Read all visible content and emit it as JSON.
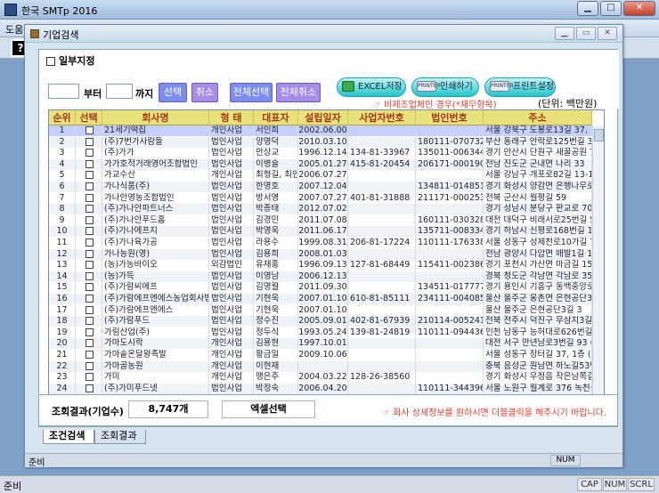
{
  "app": {
    "title": "한국 SMTp 2016",
    "menu": [
      "도움말"
    ]
  },
  "status": {
    "ready": "준비",
    "indicators": [
      "CAP",
      "NUM",
      "SCRL"
    ]
  },
  "window": {
    "title": "기업검색"
  },
  "filter": {
    "partial_label": "일부지정",
    "from_label": "부터",
    "to_label": "까지",
    "from_value": "",
    "to_value": "",
    "buttons": {
      "select": "선택",
      "cancel": "취소",
      "select_all": "전체선택",
      "cancel_all": "전체취소"
    },
    "actions": {
      "excel": "EXCEL저장",
      "print": "인쇄하기",
      "print_setup": "프린트설정",
      "print_icon_text": "PRINTER"
    },
    "warning": "비제조업체인 경우(*재무항목)",
    "unit": "(단위: 백만원)"
  },
  "grid": {
    "columns": [
      "순위",
      "선택",
      "회사명",
      "형 태",
      "대표자",
      "설립일자",
      "사업자번호",
      "법인번호",
      "주소"
    ],
    "rows": [
      [
        "1",
        "",
        "21세기떡집",
        "개인사업",
        "서인희",
        "2002.06.00",
        "",
        "",
        "서울 강북구 도봉로13길 37, 1층 (미아"
      ],
      [
        "2",
        "",
        "(주)7번가사람들",
        "법인사업",
        "양명덕",
        "2010.03.10",
        "",
        "180111-0707323",
        "부산 동래구 안락로125번길 38 (안락동"
      ],
      [
        "3",
        "",
        "(주)가가",
        "법인사업",
        "안상교",
        "1996.12.14",
        "134-81-33967",
        "135011-0063441",
        "경기 안산시 단원구 새꿀공원 7 (정"
      ],
      [
        "4",
        "",
        "가가호적거래영어조합법인",
        "법인사업",
        "이병술",
        "2005.01.27",
        "415-81-20454",
        "206171-0001900",
        "전남 진도군 군내면 나리 33"
      ],
      [
        "5",
        "",
        "가교수산",
        "개인사업",
        "최형길, 최인",
        "2006.07.27",
        "",
        "",
        "서울 강남구 개포로82길 13-11, 3층"
      ],
      [
        "6",
        "",
        "가나식품(주)",
        "법인사업",
        "한명호",
        "2007.12.04",
        "",
        "134811-0148511",
        "경기 화성시 양감면 은행나무로 34"
      ],
      [
        "7",
        "",
        "가나안영농조합법인",
        "법인사업",
        "방서영",
        "2007.07.27",
        "401-81-31888",
        "211171-0002539",
        "전북 군산시 월평길 59"
      ],
      [
        "8",
        "",
        "(주)가나안파트너스",
        "법인사업",
        "박종태",
        "2012.07.02",
        "",
        "",
        "경기 성남시 분당구 판교로 700, 비"
      ],
      [
        "9",
        "",
        "(주)가나안푸드홈",
        "법인사업",
        "김경민",
        "2011.07.08",
        "",
        "160111-0303282",
        "대전 대덕구 비래서로25번길 54"
      ],
      [
        "10",
        "",
        "(주)가나에프지",
        "법인사업",
        "박영욱",
        "2011.06.17",
        "",
        "135711-0083346",
        "경기 하남시 신평로168번길 104-7"
      ],
      [
        "11",
        "",
        "(주)가나육가공",
        "법인사업",
        "라용수",
        "1999.08.31",
        "206-81-17224",
        "110111-1763386",
        "서울 성동구 성제천로10가길 72-14"
      ],
      [
        "12",
        "",
        "가나농원(영)",
        "법인사업",
        "김용희",
        "2008.01.03",
        "",
        "",
        "전남 광양시 다압면 매발1길 110-11"
      ],
      [
        "13",
        "",
        "(농)가농바이오",
        "외감법인",
        "유재홍",
        "1996.09.13",
        "127-81-68449",
        "115411-0023863",
        "경기 포천시 가산면 마금길 151"
      ],
      [
        "14",
        "",
        "(농)가득",
        "법인사업",
        "이영남",
        "2006.12.13",
        "",
        "",
        "경북 청도군 각남면 각남로 35"
      ],
      [
        "15",
        "",
        "(주)가람씨에프",
        "법인사업",
        "김명월",
        "2011.09.30",
        "",
        "134511-0177772",
        "경기 용인시 기흥구 동백중앙로 191"
      ],
      [
        "16",
        "",
        "(주)가람에프엔에스농업회사법",
        "법인사업",
        "기현욱",
        "2007.01.10",
        "610-81-85111",
        "234111-0040851",
        "울산 울주군 웅촌면 은현공단3길 3"
      ],
      [
        "17",
        "",
        "(주)가람에프엔에스",
        "법인사업",
        "기현욱",
        "2007.01.10",
        "",
        "",
        "울산 울주군 은현공단3길 3"
      ],
      [
        "18",
        "",
        "(주)가람푸드",
        "법인사업",
        "정수진",
        "2005.09.01",
        "402-81-67939",
        "210114-0052410",
        "전북 전주시 덕진구 무삼지3길 9-1"
      ],
      [
        "19",
        "",
        "가림산업(주)",
        "법인사업",
        "정두식",
        "1993.05.24",
        "139-81-24819",
        "110111-0944367",
        "인천 남동구 능허대로626번길 63, 1"
      ],
      [
        "20",
        "",
        "가마도시락",
        "개인사업",
        "김용현",
        "1997.10.01",
        "",
        "",
        "대전 서구 만년남로3번길 93 (만년동"
      ],
      [
        "21",
        "",
        "가마솥온달왕족발",
        "개인사업",
        "황금일",
        "2009.10.06",
        "",
        "",
        "서울 성동구 장터길 37, 1층 (금호동"
      ],
      [
        "22",
        "",
        "가마골농원",
        "개인사업",
        "이현재",
        "",
        "",
        "",
        "충북 음성군 원남면 하노길53번길 14"
      ],
      [
        "23",
        "",
        "가미",
        "개인사업",
        "맹은주",
        "2004.03.22",
        "128-26-38560",
        "",
        "경기 화성시 우정읍 작은남쪽길 54"
      ],
      [
        "24",
        "",
        "(주)가미푸드넷",
        "법인사업",
        "박정숙",
        "2006.04.20",
        "",
        "110111-3443960",
        "서울 노원구 월계로 376 녹천중학교"
      ]
    ]
  },
  "result": {
    "label": "조회결과(기업수)",
    "count": "8,747개",
    "cell_select": "엑셀선택",
    "note": "회사 상세정보를 원하시면 더블클릭을 해주시기 바랍니다."
  },
  "tabs": [
    "조건검색",
    "조회결과"
  ],
  "inner_status": {
    "ready": "준비",
    "num": "NUM"
  }
}
